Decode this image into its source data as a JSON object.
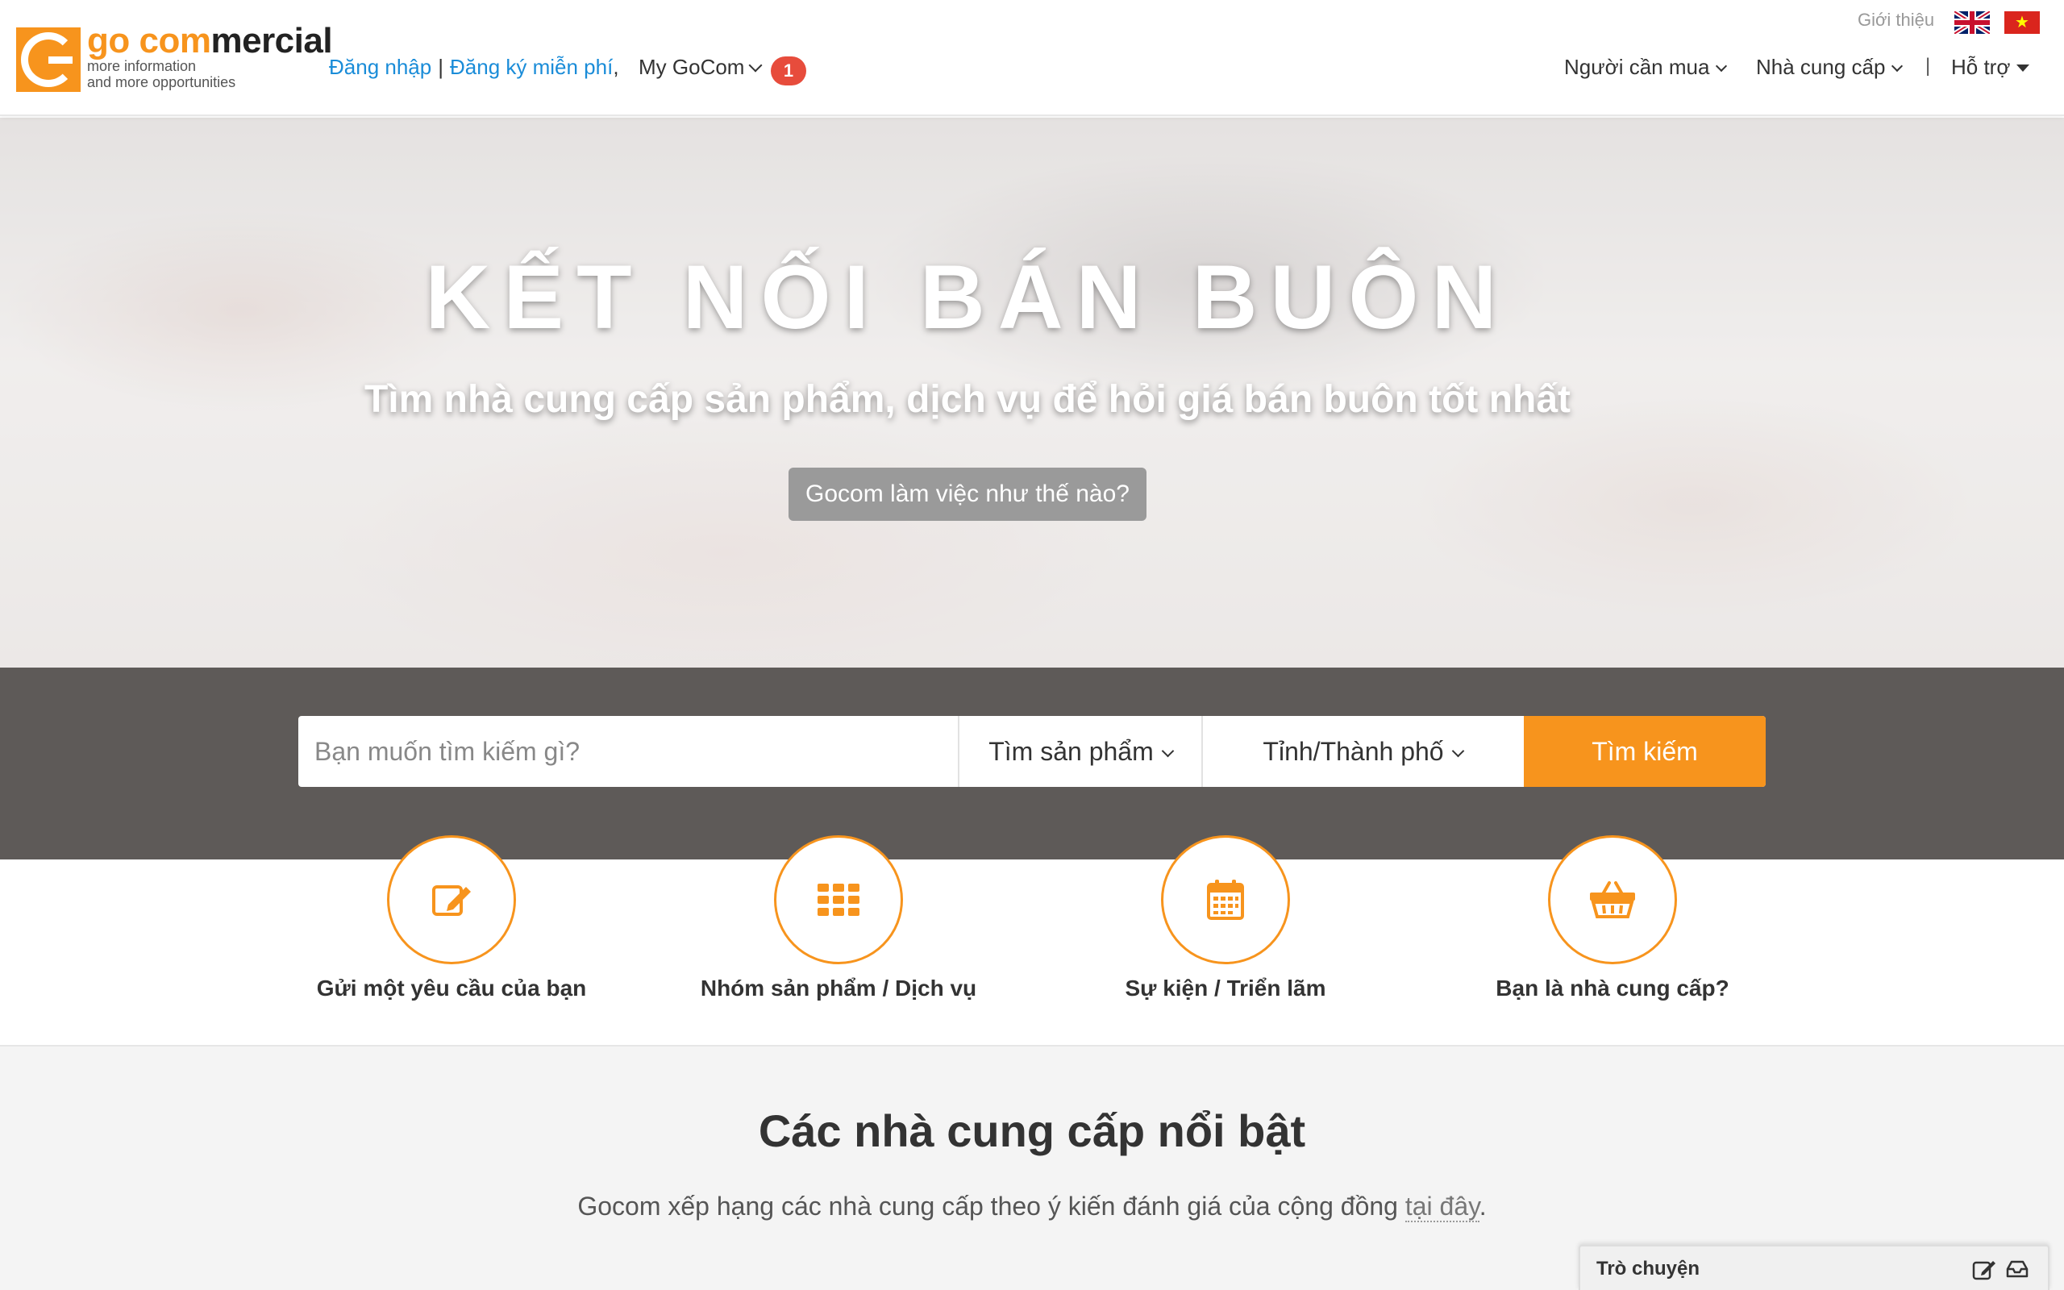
{
  "header": {
    "logo": {
      "word_go": "go ",
      "word_com": "com",
      "word_mercial": "mercial",
      "tagline_1": "more information",
      "tagline_2": "and more opportunities"
    },
    "login": "Đăng nhập",
    "separator": "|",
    "register": "Đăng ký miễn phí",
    "comma": ",",
    "my_gocom": "My GoCom",
    "notification_count": "1",
    "about": "Giới thiệu",
    "nav": {
      "buyers": "Người cần mua",
      "suppliers": "Nhà cung cấp",
      "separator": "|",
      "support": "Hỗ trợ"
    },
    "flags": [
      "en-flag",
      "vi-flag"
    ]
  },
  "hero": {
    "title": "KẾT NỐI BÁN BUÔN",
    "subtitle": "Tìm nhà cung cấp sản phẩm, dịch vụ để hỏi giá bán buôn tốt nhất",
    "how_button": "Gocom làm việc như thế nào?"
  },
  "search": {
    "placeholder": "Bạn muốn tìm kiếm gì?",
    "type_selected": "Tìm sản phẩm",
    "city_selected": "Tỉnh/Thành phố",
    "button": "Tìm kiếm"
  },
  "features": [
    {
      "label": "Gửi một yêu cầu của bạn",
      "icon": "edit-icon"
    },
    {
      "label": "Nhóm sản phẩm / Dịch vụ",
      "icon": "grid-icon"
    },
    {
      "label": "Sự kiện / Triển lãm",
      "icon": "calendar-icon"
    },
    {
      "label": "Bạn là nhà cung cấp?",
      "icon": "basket-icon"
    }
  ],
  "suppliers": {
    "title": "Các nhà cung cấp nổi bật",
    "desc_before": "Gocom xếp hạng các nhà cung cấp theo ý kiến đánh giá của cộng đồng ",
    "desc_link": "tại đây",
    "desc_after": "."
  },
  "chat": {
    "label": "Trò chuyện"
  },
  "colors": {
    "accent": "#f7941d",
    "link": "#1a8cd8",
    "badge": "#e74c3c"
  }
}
